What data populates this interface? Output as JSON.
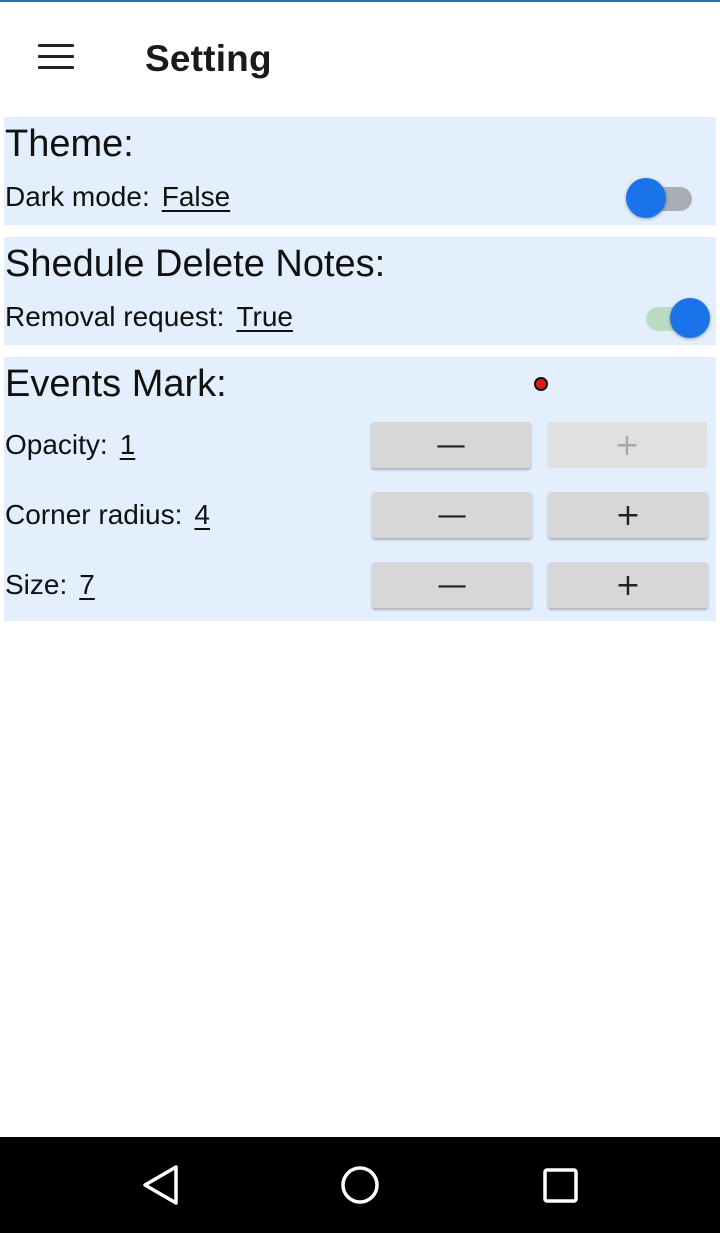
{
  "app_bar": {
    "title": "Setting",
    "menu_icon": "hamburger-menu-icon"
  },
  "theme": {
    "heading": "Theme:",
    "dark_mode_label": "Dark mode:",
    "dark_mode_value": "False",
    "dark_mode_on": false
  },
  "schedule_delete": {
    "heading": "Shedule Delete Notes:",
    "removal_label": "Removal request:",
    "removal_value": "True",
    "removal_on": true
  },
  "events_mark": {
    "heading": "Events Mark:",
    "marker_color": "#e01818",
    "opacity_label": "Opacity:",
    "opacity_value": "1",
    "corner_label": "Corner radius:",
    "corner_value": "4",
    "size_label": "Size:",
    "size_value": "7",
    "minus_symbol": "—",
    "plus_symbol": "+"
  },
  "colors": {
    "section_bg": "#e3effd",
    "accent": "#1a73e8"
  },
  "nav": {
    "back_icon": "back-triangle-icon",
    "home_icon": "home-circle-icon",
    "recent_icon": "recent-apps-square-icon"
  }
}
